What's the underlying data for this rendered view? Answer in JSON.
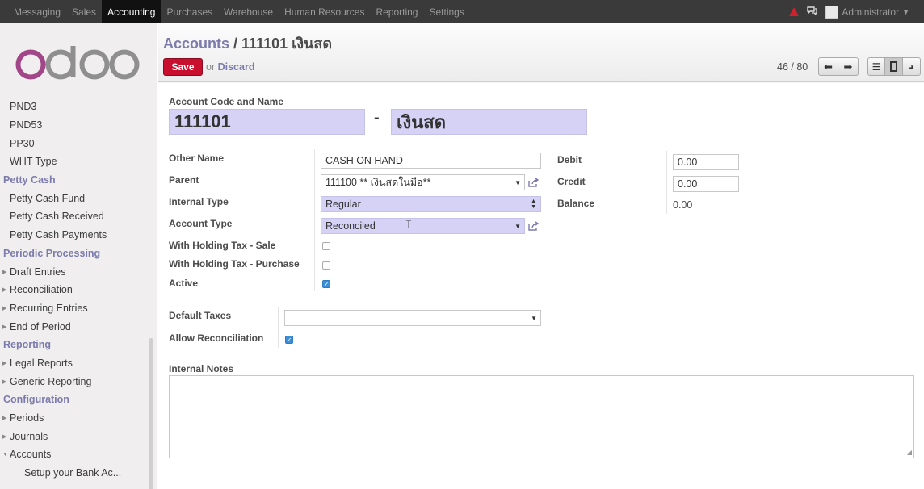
{
  "topbar": {
    "menu": [
      "Messaging",
      "Sales",
      "Accounting",
      "Purchases",
      "Warehouse",
      "Human Resources",
      "Reporting",
      "Settings"
    ],
    "active": "Accounting",
    "user": "Administrator"
  },
  "sidebar": {
    "logo": "odoo",
    "items": [
      {
        "label": "PND3",
        "kind": "item"
      },
      {
        "label": "PND53",
        "kind": "item"
      },
      {
        "label": "PP30",
        "kind": "item"
      },
      {
        "label": "WHT Type",
        "kind": "item"
      },
      {
        "label": "Petty Cash",
        "kind": "section"
      },
      {
        "label": "Petty Cash Fund",
        "kind": "item"
      },
      {
        "label": "Petty Cash Received",
        "kind": "item"
      },
      {
        "label": "Petty Cash Payments",
        "kind": "item"
      },
      {
        "label": "Periodic Processing",
        "kind": "section"
      },
      {
        "label": "Draft Entries",
        "kind": "tree"
      },
      {
        "label": "Reconciliation",
        "kind": "tree"
      },
      {
        "label": "Recurring Entries",
        "kind": "tree"
      },
      {
        "label": "End of Period",
        "kind": "tree"
      },
      {
        "label": "Reporting",
        "kind": "section"
      },
      {
        "label": "Legal Reports",
        "kind": "tree"
      },
      {
        "label": "Generic Reporting",
        "kind": "tree"
      },
      {
        "label": "Configuration",
        "kind": "section"
      },
      {
        "label": "Periods",
        "kind": "tree"
      },
      {
        "label": "Journals",
        "kind": "tree"
      },
      {
        "label": "Accounts",
        "kind": "tree-open"
      },
      {
        "label": "Setup your Bank Ac...",
        "kind": "sub"
      }
    ]
  },
  "header": {
    "breadcrumb_root": "Accounts",
    "breadcrumb_sep": " / ",
    "breadcrumb_current": "111101 เงินสด",
    "save_label": "Save",
    "or_label": "or",
    "discard_label": "Discard",
    "pager": "46 / 80"
  },
  "form": {
    "code_name_label": "Account Code and Name",
    "code": "111101",
    "dash": "-",
    "name": "เงินสด",
    "other_name_label": "Other Name",
    "other_name": "CASH ON HAND",
    "parent_label": "Parent",
    "parent": "111100 ** เงินสดในมือ**",
    "internal_type_label": "Internal Type",
    "internal_type": "Regular",
    "account_type_label": "Account Type",
    "account_type": "Reconciled",
    "wht_sale_label": "With Holding Tax - Sale",
    "wht_sale": false,
    "wht_purchase_label": "With Holding Tax - Purchase",
    "wht_purchase": false,
    "active_label": "Active",
    "active": true,
    "debit_label": "Debit",
    "debit": "0.00",
    "credit_label": "Credit",
    "credit": "0.00",
    "balance_label": "Balance",
    "balance": "0.00",
    "default_taxes_label": "Default Taxes",
    "default_taxes": "",
    "allow_reconciliation_label": "Allow Reconciliation",
    "allow_reconciliation": true,
    "internal_notes_label": "Internal Notes",
    "internal_notes": ""
  },
  "colors": {
    "brand": "#7c7bad",
    "save": "#c8102e",
    "required_field": "#d5d2f5",
    "topbar": "#3a3a3a"
  }
}
